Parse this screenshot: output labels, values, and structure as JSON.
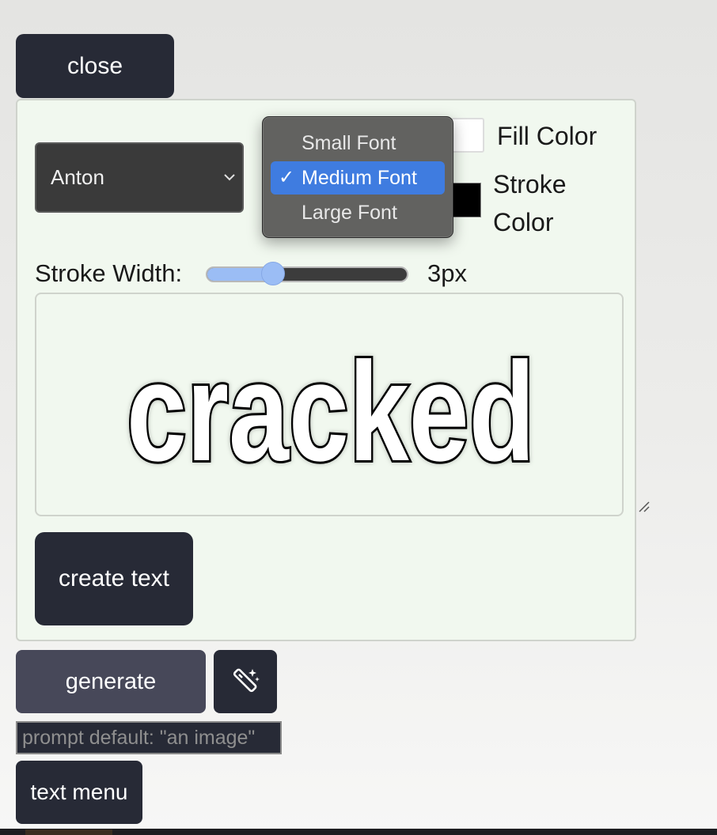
{
  "buttons": {
    "close": "close",
    "create_text": "create text",
    "generate": "generate",
    "text_menu": "text menu"
  },
  "font_select": {
    "value": "Anton"
  },
  "font_size_options": [
    "Small Font",
    "Medium Font",
    "Large Font"
  ],
  "font_size_selected": "Medium Font",
  "fill_color": {
    "label": "Fill Color",
    "value": "#ffffff"
  },
  "stroke_color": {
    "label": "Stroke Color",
    "value": "#000000"
  },
  "stroke_width": {
    "label": "Stroke Width:",
    "value_text": "3px",
    "level": 0.33
  },
  "preview_text": "cracked",
  "prompt": {
    "placeholder": "prompt default: \"an image\""
  },
  "icons": [
    "chevron-down-icon",
    "magic-wand-icon",
    "resize-handle-icon",
    "checkmark-icon"
  ],
  "colors": {
    "button_dark": "#272a36",
    "generate_button": "#474859",
    "panel_bg": "#f1f8ef",
    "accent": "#3f7ce0",
    "slider": "#9bbdf5"
  }
}
